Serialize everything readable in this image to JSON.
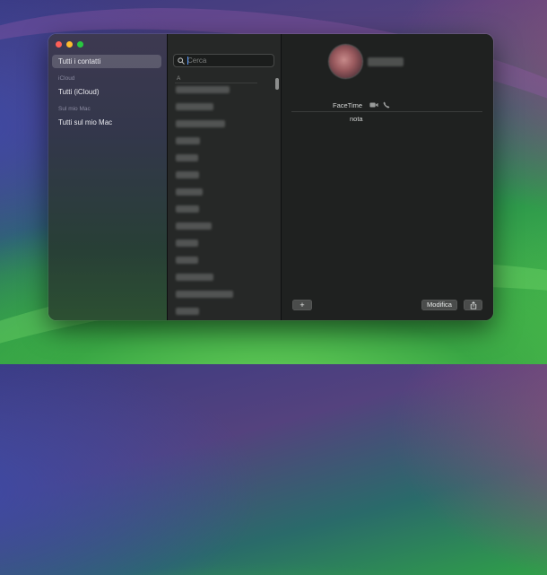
{
  "sidebar": {
    "all_contacts": "Tutti i contatti",
    "icloud_header": "iCloud",
    "icloud_all": "Tutti (iCloud)",
    "mac_header": "Sul mio Mac",
    "mac_all": "Tutti sul mio Mac"
  },
  "search": {
    "placeholder": "Cerca"
  },
  "list": {
    "section_letter": "A",
    "contact_count": 14
  },
  "detail": {
    "facetime_label": "FaceTime",
    "note_label": "nota",
    "add_label": "+",
    "edit_label": "Modifica"
  },
  "icons": {
    "search": "search-icon",
    "video": "video-icon",
    "phone": "phone-icon",
    "share": "share-icon"
  },
  "colors": {
    "close": "#ff5f57",
    "minimize": "#febc2e",
    "maximize": "#28c840",
    "accent": "#5a9bff"
  }
}
